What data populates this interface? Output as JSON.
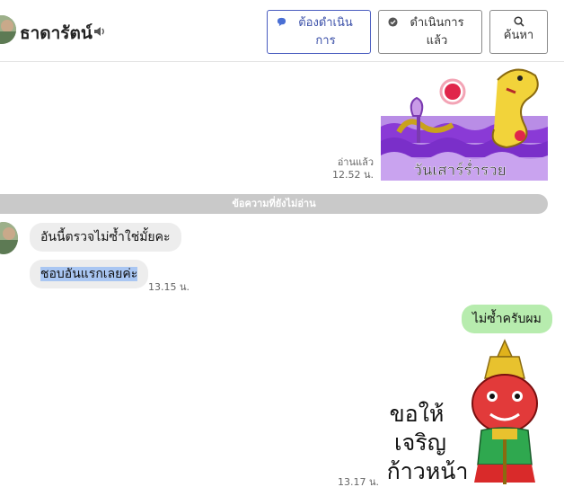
{
  "header": {
    "contact_name": "ธาดารัตน์",
    "btn_todo": "ต้องดำเนินการ",
    "btn_done": "ดำเนินการแล้ว",
    "btn_search": "ค้นหา",
    "accent": "#3a4fa8"
  },
  "messages": {
    "read_status": "อ่านแล้ว",
    "time_1": "12.52 น.",
    "sticker_1_text": "วันเสาร์ร่ำรวย",
    "unread_divider": "ข้อความที่ยังไม่อ่าน",
    "incoming_1": "อันนี้ตรวจไม่ซ้ำใช่มั้ยคะ",
    "incoming_2": "ชอบอันแรกเลยค่ะ",
    "time_2": "13.15 น.",
    "outgoing_1": "ไม่ซ้ำครับผม",
    "time_3": "13.17 น.",
    "sticker_2_text_line1": "ขอให้",
    "sticker_2_text_line2": "เจริญ",
    "sticker_2_text_line3": "ก้าวหน้า",
    "bubble_in_color": "#ededed",
    "bubble_out_color": "#b7ecae"
  }
}
